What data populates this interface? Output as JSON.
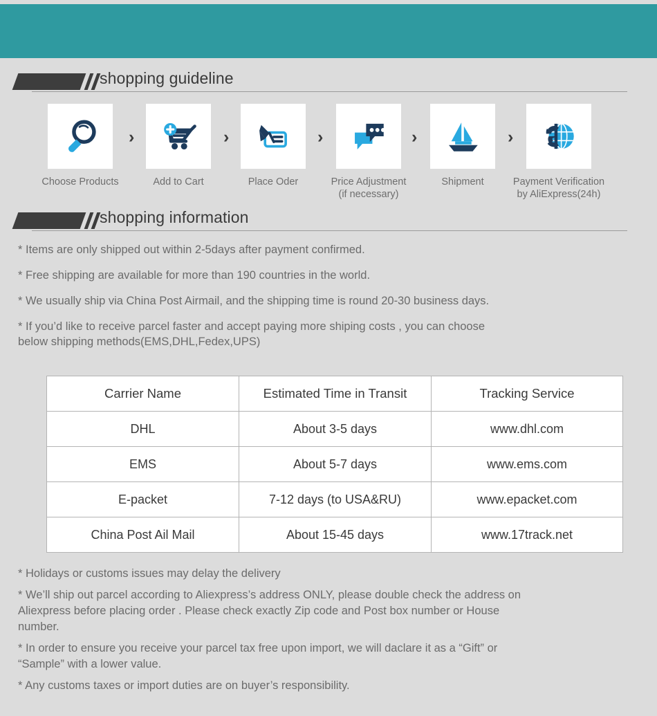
{
  "colors": {
    "banner_teal": "#2f9aa0",
    "page_background": "#dcdcdc",
    "icon_dark_blue": "#1d3b5c",
    "icon_light_blue": "#29a9e0",
    "header_bar": "#3d3d3d",
    "body_text": "#6b6b6b",
    "table_text": "#3a3a3a",
    "table_border": "#b4b4b4"
  },
  "sections": {
    "guideline": {
      "title": "shopping guideline"
    },
    "information": {
      "title": "shopping information"
    }
  },
  "steps": [
    {
      "icon": "magnifier-icon",
      "label": "Choose Products"
    },
    {
      "icon": "shopping-cart-plus-icon",
      "label": "Add to Cart"
    },
    {
      "icon": "pen-order-form-icon",
      "label": "Place Oder"
    },
    {
      "icon": "chat-bubbles-icon",
      "label": "Price Adjustment\n(if necessary)"
    },
    {
      "icon": "sailboat-icon",
      "label": "Shipment"
    },
    {
      "icon": "dollar-globe-icon",
      "label": "Payment Verification\nby AliExpress(24h)"
    }
  ],
  "step_separator": "›",
  "info_lines": [
    "* Items are only shipped out within 2-5days after payment confirmed.",
    "* Free shipping are available for more than 190 countries in the world.",
    "* We usually ship via China Post Airmail, and the shipping time is round 20-30 business days.",
    "* If you’d like to receive parcel faster and accept paying more shiping costs , you can choose\n   below shipping methods(EMS,DHL,Fedex,UPS)"
  ],
  "table": {
    "headers": [
      "Carrier Name",
      "Estimated Time in Transit",
      "Tracking Service"
    ],
    "rows": [
      [
        "DHL",
        "About 3-5 days",
        "www.dhl.com"
      ],
      [
        "EMS",
        "About 5-7 days",
        "www.ems.com"
      ],
      [
        "E-packet",
        "7-12 days (to USA&RU)",
        "www.epacket.com"
      ],
      [
        "China Post Ail Mail",
        "About 15-45 days",
        "www.17track.net"
      ]
    ]
  },
  "notes": [
    "* Holidays or customs issues may delay the delivery",
    "* We’ll ship out parcel according to Aliexpress’s address ONLY, please double check the address on\n   Aliexpress before placing order . Please check exactly Zip code and Post box  number or House\n   number.",
    "* In order to ensure you receive your parcel tax free upon import, we will daclare it as a “Gift”  or\n   “Sample”  with a lower value.",
    "* Any customs taxes or import duties are on buyer’s responsibility."
  ]
}
